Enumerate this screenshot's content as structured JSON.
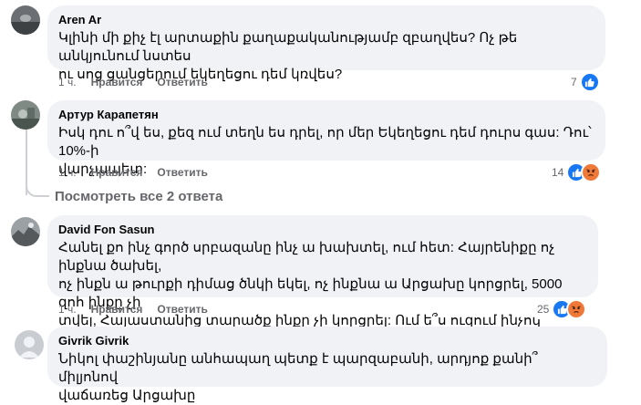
{
  "comments": [
    {
      "author": "Aren Ar",
      "text_lines": [
        "Կլինի մի քիչ էլ արտաքին քաղաքականությամբ զբաղվես? Ոչ թե անկյունում նստես",
        "ու սոց ցանցերում եկեղեցու դեմ կռվես?"
      ],
      "time": "1 ч.",
      "like_label": "Нравится",
      "reply_label": "Ответить",
      "reaction_count": "7",
      "reactions": [
        "like"
      ]
    },
    {
      "author": "Артур Карапетян",
      "text_lines": [
        "Իսկ դու ո՞վ ես, քեզ ում տեղն ես դրել, որ մեր Եկեղեցու դեմ դուրս գաս: Դու՝ 10%-ի",
        "վարչապետ:"
      ],
      "time": "1 ч.",
      "like_label": "Нравится",
      "reply_label": "Ответить",
      "reaction_count": "14",
      "reactions": [
        "like",
        "angry"
      ]
    },
    {
      "author": "David Fon Sasun",
      "text_lines": [
        "Հանել քո ինչ գործ սրբազանը ինչ ա խախտել, ում հետ: Հայրենիքը ոչ ինքնա ծախել,",
        "ոչ ինքն ա թուրքի դիմաց ծնկի եկել, ոչ ինքնա ա Արցախը կորցրել, 5000 զոհ ինքը չի",
        "տվել, Հայաստանից տարածք ինքը չի կորցրել: Ում ե՞ս ուզում ինչով ապացուցել:"
      ],
      "time": "1 ч.",
      "like_label": "Нравится",
      "reply_label": "Ответить",
      "reaction_count": "25",
      "reactions": [
        "like",
        "angry"
      ]
    },
    {
      "author": "Givrik Givrik",
      "text_lines": [
        "Նիկոլ փաշինյանը անհապաղ պետք է պարզաբանի, արդյոք քանի՞ միլյոնով",
        "վաճառեց Արցախը"
      ]
    }
  ],
  "view_replies": "Посмотреть все 2 ответа",
  "colors": {
    "bubble": "#f0f2f5",
    "like": "#1877f2",
    "angry": "#f0793a",
    "meta": "#65676b"
  }
}
